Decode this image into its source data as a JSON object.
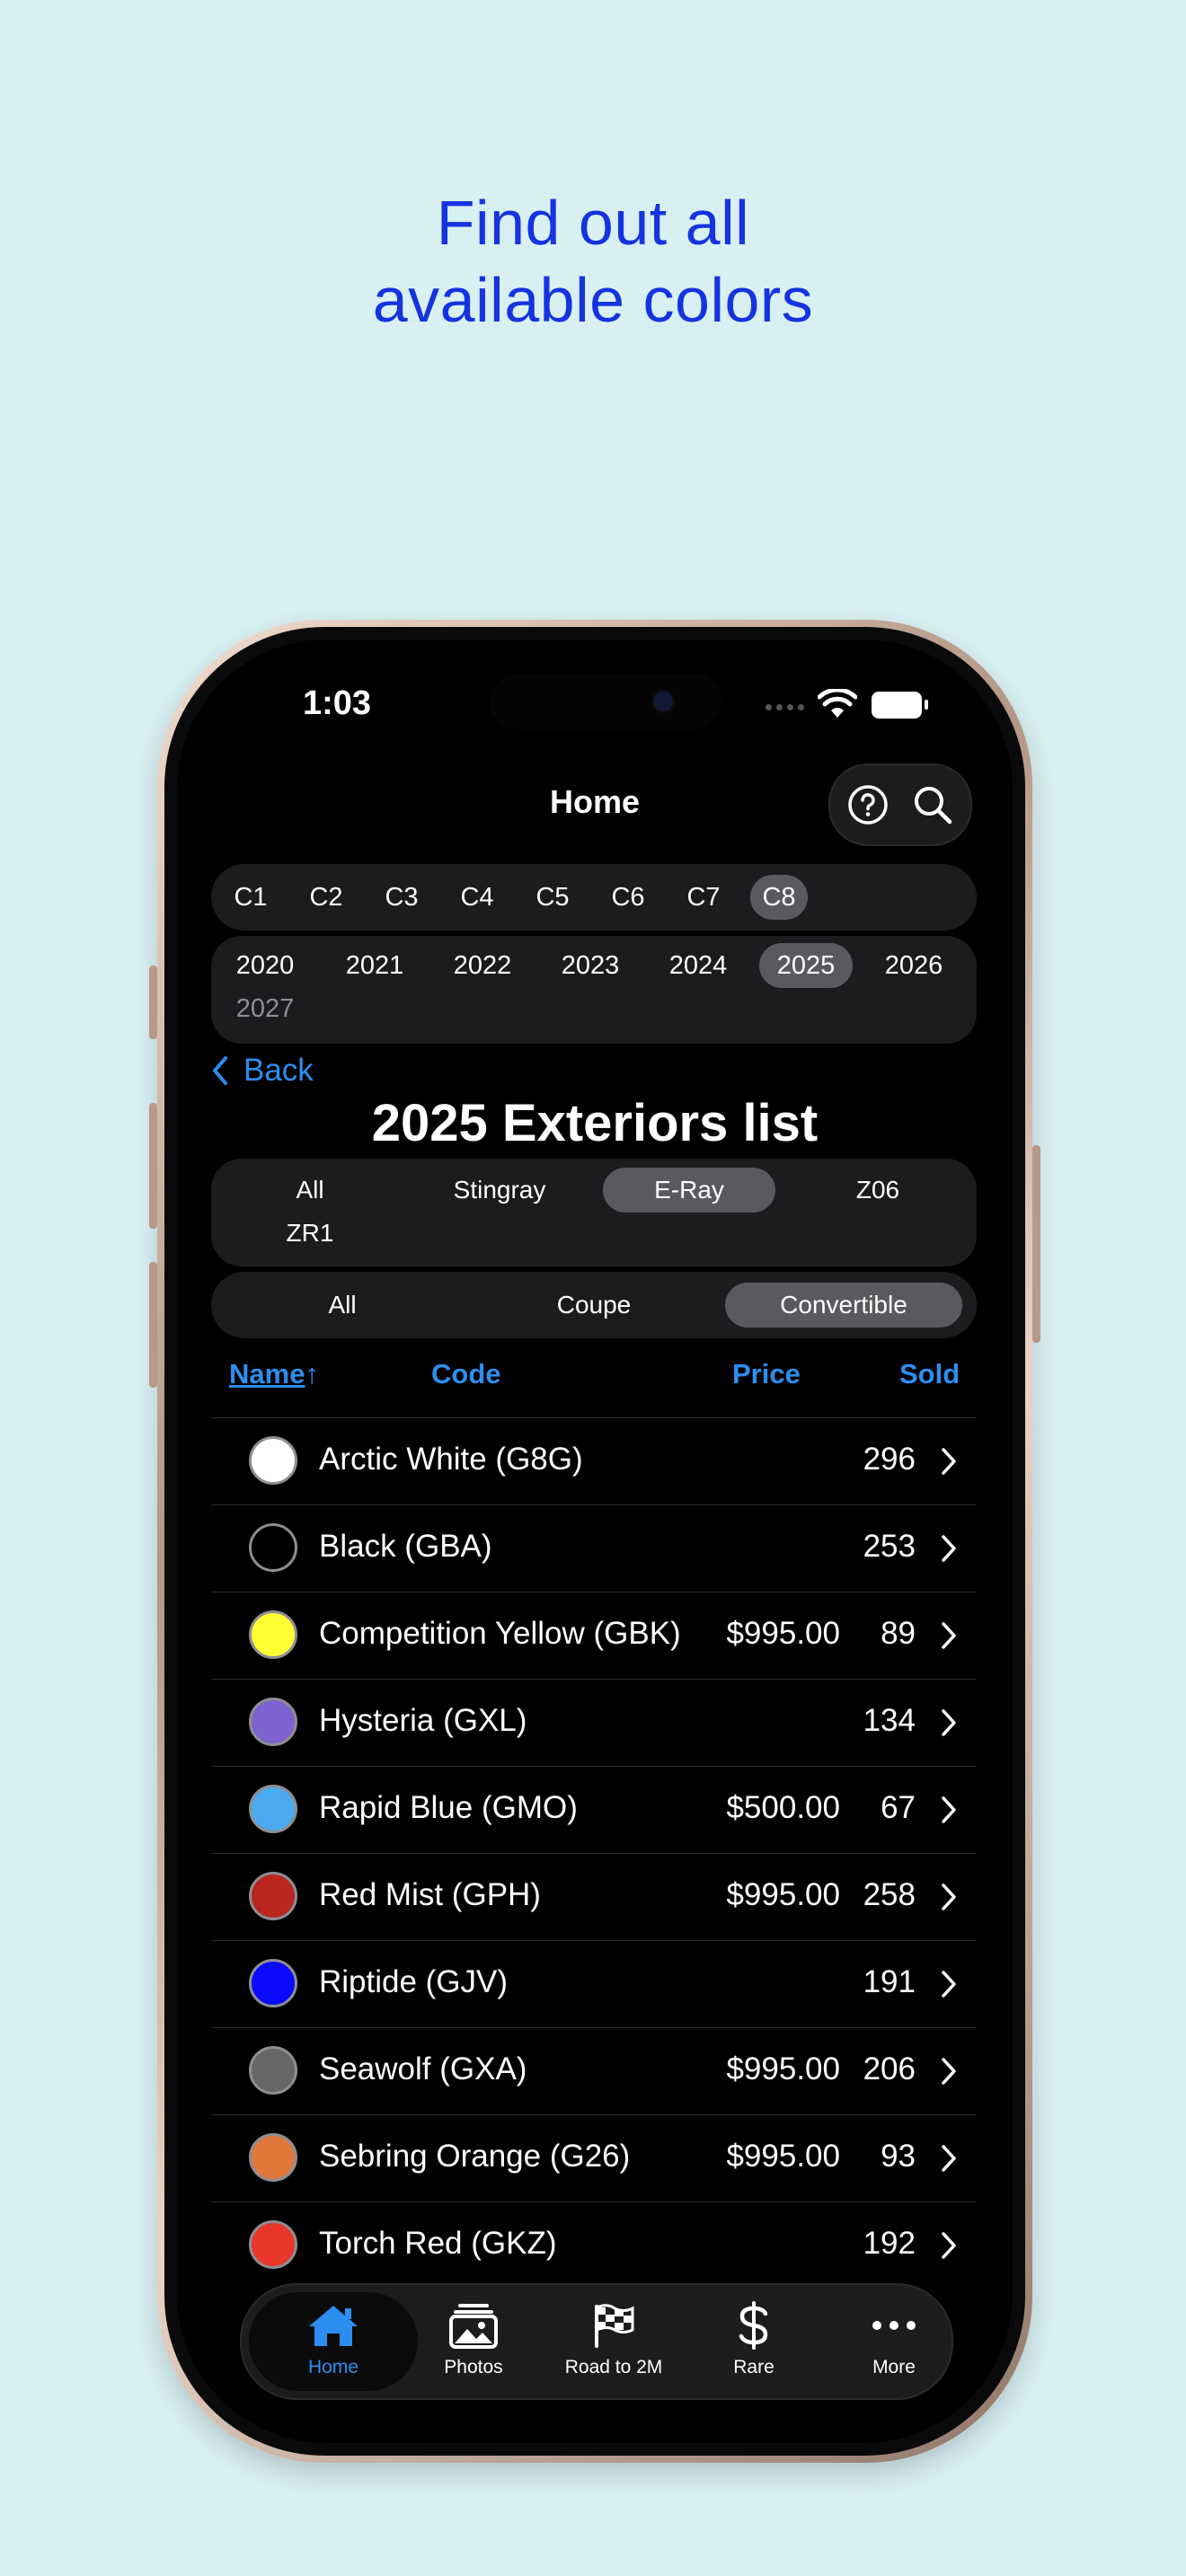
{
  "headline": {
    "line1": "Find out all",
    "line2": "available colors"
  },
  "status": {
    "time": "1:03"
  },
  "nav": {
    "title": "Home",
    "actions": [
      "help-icon",
      "search-icon"
    ]
  },
  "generations": {
    "items": [
      "C1",
      "C2",
      "C3",
      "C4",
      "C5",
      "C6",
      "C7",
      "C8"
    ],
    "selected": "C8"
  },
  "years": {
    "items": [
      "2020",
      "2021",
      "2022",
      "2023",
      "2024",
      "2025",
      "2026",
      "2027"
    ],
    "selected": "2025",
    "disabled": "2027"
  },
  "back": {
    "label": "Back"
  },
  "page_title": "2025 Exteriors list",
  "models": {
    "items": [
      "All",
      "Stingray",
      "E-Ray",
      "Z06",
      "ZR1"
    ],
    "selected": "E-Ray"
  },
  "bodies": {
    "items": [
      "All",
      "Coupe",
      "Convertible"
    ],
    "selected": "Convertible"
  },
  "table": {
    "headers": {
      "name": "Name",
      "code": "Code",
      "price": "Price",
      "sold": "Sold"
    },
    "sort_indicator": "↑",
    "rows": [
      {
        "name": "Arctic White (G8G)",
        "price": "",
        "sold": "296",
        "color": "#ffffff"
      },
      {
        "name": "Black (GBA)",
        "price": "",
        "sold": "253",
        "color": "#000000"
      },
      {
        "name": "Competition Yellow (GBK)",
        "price": "$995.00",
        "sold": "89",
        "color": "#ffff33"
      },
      {
        "name": "Hysteria (GXL)",
        "price": "",
        "sold": "134",
        "color": "#7d62d0"
      },
      {
        "name": "Rapid Blue (GMO)",
        "price": "$500.00",
        "sold": "67",
        "color": "#4aaaf0"
      },
      {
        "name": "Red Mist (GPH)",
        "price": "$995.00",
        "sold": "258",
        "color": "#b8261e"
      },
      {
        "name": "Riptide (GJV)",
        "price": "",
        "sold": "191",
        "color": "#0a0aff"
      },
      {
        "name": "Seawolf (GXA)",
        "price": "$995.00",
        "sold": "206",
        "color": "#666666"
      },
      {
        "name": "Sebring Orange (G26)",
        "price": "$995.00",
        "sold": "93",
        "color": "#e0773b"
      },
      {
        "name": "Torch Red (GKZ)",
        "price": "",
        "sold": "192",
        "color": "#e8362a"
      }
    ]
  },
  "tabs": [
    {
      "label": "Home",
      "icon": "house-icon",
      "active": true
    },
    {
      "label": "Photos",
      "icon": "photos-icon",
      "active": false
    },
    {
      "label": "Road to 2M",
      "icon": "checkered-flag-icon",
      "active": false
    },
    {
      "label": "Rare",
      "icon": "dollar-icon",
      "active": false
    },
    {
      "label": "More",
      "icon": "ellipsis-icon",
      "active": false
    }
  ],
  "colors": {
    "background": "#d9f0f3",
    "headline": "#1533e0",
    "accent": "#2c8ef0",
    "selected_pill": "#5a5a5e",
    "bar_bg": "#1c1c1e"
  }
}
